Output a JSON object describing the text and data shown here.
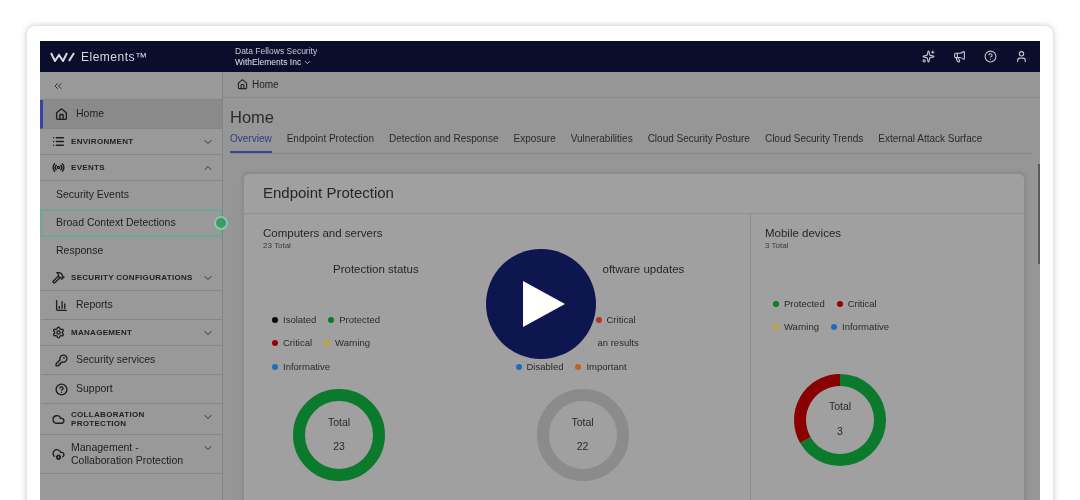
{
  "header": {
    "product": "Elements™",
    "org_caption": "Data Fellows Security",
    "org_name": "WithElements Inc"
  },
  "sidebar": {
    "items": [
      {
        "kind": "link",
        "label": "Home",
        "selected": true,
        "highlighted": false
      },
      {
        "kind": "section",
        "label": "ENVIRONMENT",
        "expanded": false
      },
      {
        "kind": "section",
        "label": "EVENTS",
        "expanded": true
      },
      {
        "kind": "subitem",
        "label": "Security Events",
        "selected": false,
        "highlighted": false
      },
      {
        "kind": "subitem",
        "label": "Broad Context Detections",
        "selected": false,
        "highlighted": true
      },
      {
        "kind": "subitem",
        "label": "Response",
        "selected": false,
        "highlighted": false
      },
      {
        "kind": "section",
        "label": "SECURITY CONFIGURATIONS",
        "expanded": false
      },
      {
        "kind": "link",
        "label": "Reports",
        "selected": false,
        "highlighted": false
      },
      {
        "kind": "section",
        "label": "MANAGEMENT",
        "expanded": false
      },
      {
        "kind": "link",
        "label": "Security services",
        "selected": false,
        "highlighted": false
      },
      {
        "kind": "link",
        "label": "Support",
        "selected": false,
        "highlighted": false
      },
      {
        "kind": "section",
        "label": "COLLABORATION PROTECTION",
        "expanded": false
      },
      {
        "kind": "group",
        "label": "Management - Collaboration Protection",
        "expanded": false
      }
    ]
  },
  "breadcrumb": "Home",
  "page_title": "Home",
  "tabs": [
    {
      "label": "Overview",
      "selected": true
    },
    {
      "label": "Endpoint Protection",
      "selected": false
    },
    {
      "label": "Detection and Response",
      "selected": false
    },
    {
      "label": "Exposure",
      "selected": false
    },
    {
      "label": "Vulnerabilities",
      "selected": false
    },
    {
      "label": "Cloud Security Posture",
      "selected": false
    },
    {
      "label": "Cloud Security Trends",
      "selected": false
    },
    {
      "label": "External Attack Surface",
      "selected": false
    }
  ],
  "card": {
    "title": "Endpoint Protection",
    "computers": {
      "title": "Computers and servers",
      "subtitle": "23 Total",
      "charts": [
        {
          "title": "Protection status",
          "legend": [
            [
              {
                "label": "Isolated",
                "color": "#050505"
              },
              {
                "label": "Protected",
                "color": "#0b7a2c"
              }
            ],
            [
              {
                "label": "Critical",
                "color": "#9a0000"
              },
              {
                "label": "Warning",
                "color": "#b5a63a"
              }
            ],
            [
              {
                "label": "Informative",
                "color": "#1c6cc0"
              }
            ]
          ],
          "total_label": "Total",
          "total": "23"
        },
        {
          "title": "oftware updates",
          "legend": [
            [
              {
                "label": "Critical",
                "color": "#b03a20"
              }
            ],
            [
              {
                "label": "an results"
              }
            ],
            [
              {
                "label": "Disabled",
                "color": "#1c6cc0"
              },
              {
                "label": "Important",
                "color": "#c0621c"
              }
            ]
          ],
          "total_label": "Total",
          "total": "22"
        }
      ]
    },
    "mobile": {
      "title": "Mobile devices",
      "subtitle": "3 Total",
      "chart": {
        "legend": [
          [
            {
              "label": "Protected",
              "color": "#0b7a2c"
            },
            {
              "label": "Critical",
              "color": "#9a0000"
            }
          ],
          [
            {
              "label": "Warning",
              "color": "#b5a63a"
            },
            {
              "label": "Informative",
              "color": "#1c6cc0"
            }
          ]
        ],
        "total_label": "Total",
        "total": "3"
      }
    }
  }
}
